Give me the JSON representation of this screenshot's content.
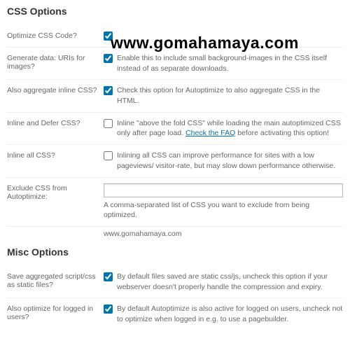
{
  "watermark": "www.gomahamaya.com",
  "watermark_small": "www.gomahamaya.com",
  "sections": {
    "css": {
      "title": "CSS Options",
      "rows": {
        "optimize": {
          "label": "Optimize CSS Code?",
          "checked": true,
          "desc": ""
        },
        "data_uris": {
          "label": "Generate data: URIs for images?",
          "checked": true,
          "desc": "Enable this to include small background-images in the CSS itself instead of as separate downloads."
        },
        "aggregate_inline": {
          "label": "Also aggregate inline CSS?",
          "checked": true,
          "desc": "Check this option for Autoptimize to also aggregate CSS in the HTML."
        },
        "inline_defer": {
          "label": "Inline and Defer CSS?",
          "checked": false,
          "desc_pre": "Inline \"above the fold CSS\" while loading the main autoptimized CSS only after page load. ",
          "link": "Check the FAQ",
          "desc_post": " before activating this option!"
        },
        "inline_all": {
          "label": "Inline all CSS?",
          "checked": false,
          "desc": "Inlining all CSS can improve performance for sites with a low pageviews/ visitor-rate, but may slow down performance otherwise."
        },
        "exclude": {
          "label": "Exclude CSS from Autoptimize:",
          "value": "",
          "desc": "A comma-separated list of CSS you want to exclude from being optimized."
        }
      }
    },
    "misc": {
      "title": "Misc Options",
      "rows": {
        "save_static": {
          "label": "Save aggregated script/css as static files?",
          "checked": true,
          "desc": "By default files saved are static css/js, uncheck this option if your webserver doesn't properly handle the compression and expiry."
        },
        "logged_in": {
          "label": "Also optimize for logged in users?",
          "checked": true,
          "desc": "By default Autoptimize is also active for logged on users, uncheck not to optimize when logged in e.g. to use a pagebuilder."
        }
      }
    }
  }
}
